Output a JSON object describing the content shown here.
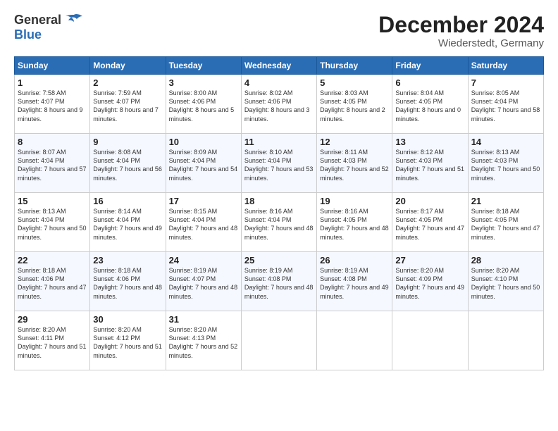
{
  "logo": {
    "general": "General",
    "blue": "Blue"
  },
  "header": {
    "title": "December 2024",
    "subtitle": "Wiederstedt, Germany"
  },
  "days_of_week": [
    "Sunday",
    "Monday",
    "Tuesday",
    "Wednesday",
    "Thursday",
    "Friday",
    "Saturday"
  ],
  "weeks": [
    [
      {
        "day": "1",
        "sunrise": "7:58 AM",
        "sunset": "4:07 PM",
        "daylight": "8 hours and 9 minutes."
      },
      {
        "day": "2",
        "sunrise": "7:59 AM",
        "sunset": "4:07 PM",
        "daylight": "8 hours and 7 minutes."
      },
      {
        "day": "3",
        "sunrise": "8:00 AM",
        "sunset": "4:06 PM",
        "daylight": "8 hours and 5 minutes."
      },
      {
        "day": "4",
        "sunrise": "8:02 AM",
        "sunset": "4:06 PM",
        "daylight": "8 hours and 3 minutes."
      },
      {
        "day": "5",
        "sunrise": "8:03 AM",
        "sunset": "4:05 PM",
        "daylight": "8 hours and 2 minutes."
      },
      {
        "day": "6",
        "sunrise": "8:04 AM",
        "sunset": "4:05 PM",
        "daylight": "8 hours and 0 minutes."
      },
      {
        "day": "7",
        "sunrise": "8:05 AM",
        "sunset": "4:04 PM",
        "daylight": "7 hours and 58 minutes."
      }
    ],
    [
      {
        "day": "8",
        "sunrise": "8:07 AM",
        "sunset": "4:04 PM",
        "daylight": "7 hours and 57 minutes."
      },
      {
        "day": "9",
        "sunrise": "8:08 AM",
        "sunset": "4:04 PM",
        "daylight": "7 hours and 56 minutes."
      },
      {
        "day": "10",
        "sunrise": "8:09 AM",
        "sunset": "4:04 PM",
        "daylight": "7 hours and 54 minutes."
      },
      {
        "day": "11",
        "sunrise": "8:10 AM",
        "sunset": "4:04 PM",
        "daylight": "7 hours and 53 minutes."
      },
      {
        "day": "12",
        "sunrise": "8:11 AM",
        "sunset": "4:03 PM",
        "daylight": "7 hours and 52 minutes."
      },
      {
        "day": "13",
        "sunrise": "8:12 AM",
        "sunset": "4:03 PM",
        "daylight": "7 hours and 51 minutes."
      },
      {
        "day": "14",
        "sunrise": "8:13 AM",
        "sunset": "4:03 PM",
        "daylight": "7 hours and 50 minutes."
      }
    ],
    [
      {
        "day": "15",
        "sunrise": "8:13 AM",
        "sunset": "4:04 PM",
        "daylight": "7 hours and 50 minutes."
      },
      {
        "day": "16",
        "sunrise": "8:14 AM",
        "sunset": "4:04 PM",
        "daylight": "7 hours and 49 minutes."
      },
      {
        "day": "17",
        "sunrise": "8:15 AM",
        "sunset": "4:04 PM",
        "daylight": "7 hours and 48 minutes."
      },
      {
        "day": "18",
        "sunrise": "8:16 AM",
        "sunset": "4:04 PM",
        "daylight": "7 hours and 48 minutes."
      },
      {
        "day": "19",
        "sunrise": "8:16 AM",
        "sunset": "4:05 PM",
        "daylight": "7 hours and 48 minutes."
      },
      {
        "day": "20",
        "sunrise": "8:17 AM",
        "sunset": "4:05 PM",
        "daylight": "7 hours and 47 minutes."
      },
      {
        "day": "21",
        "sunrise": "8:18 AM",
        "sunset": "4:05 PM",
        "daylight": "7 hours and 47 minutes."
      }
    ],
    [
      {
        "day": "22",
        "sunrise": "8:18 AM",
        "sunset": "4:06 PM",
        "daylight": "7 hours and 47 minutes."
      },
      {
        "day": "23",
        "sunrise": "8:18 AM",
        "sunset": "4:06 PM",
        "daylight": "7 hours and 48 minutes."
      },
      {
        "day": "24",
        "sunrise": "8:19 AM",
        "sunset": "4:07 PM",
        "daylight": "7 hours and 48 minutes."
      },
      {
        "day": "25",
        "sunrise": "8:19 AM",
        "sunset": "4:08 PM",
        "daylight": "7 hours and 48 minutes."
      },
      {
        "day": "26",
        "sunrise": "8:19 AM",
        "sunset": "4:08 PM",
        "daylight": "7 hours and 49 minutes."
      },
      {
        "day": "27",
        "sunrise": "8:20 AM",
        "sunset": "4:09 PM",
        "daylight": "7 hours and 49 minutes."
      },
      {
        "day": "28",
        "sunrise": "8:20 AM",
        "sunset": "4:10 PM",
        "daylight": "7 hours and 50 minutes."
      }
    ],
    [
      {
        "day": "29",
        "sunrise": "8:20 AM",
        "sunset": "4:11 PM",
        "daylight": "7 hours and 51 minutes."
      },
      {
        "day": "30",
        "sunrise": "8:20 AM",
        "sunset": "4:12 PM",
        "daylight": "7 hours and 51 minutes."
      },
      {
        "day": "31",
        "sunrise": "8:20 AM",
        "sunset": "4:13 PM",
        "daylight": "7 hours and 52 minutes."
      },
      null,
      null,
      null,
      null
    ]
  ]
}
